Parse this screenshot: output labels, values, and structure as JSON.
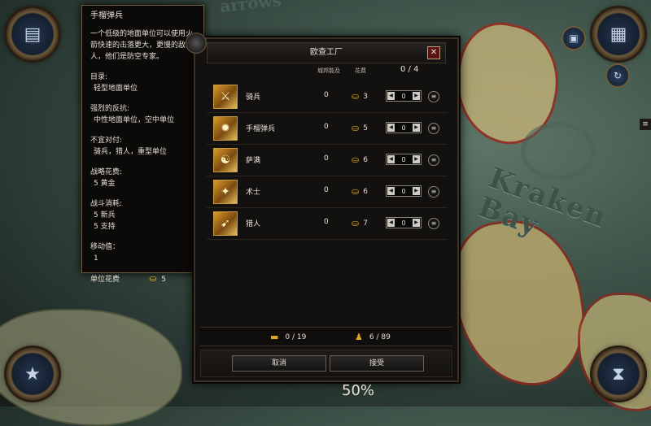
{
  "map": {
    "region_label": "Kraken Bay",
    "top_label": "arrows"
  },
  "tooltip": {
    "title": "手榴弹兵",
    "description": "一个低级的地面单位可以使用火箭快速的击落更大，更慢的敌人，他们是防空专家。",
    "target_label": "目录:",
    "target_value": "轻型地面单位",
    "strong_label": "强烈的反抗:",
    "strong_value": "中性地面单位，空中单位",
    "weak_label": "不宜对付:",
    "weak_value": "骑兵，猎人，重型单位",
    "strat_cost_label": "战略花费:",
    "strat_cost_value": "5 黄金",
    "upkeep_label": "战斗消耗:",
    "upkeep_value_1": "5 新兵",
    "upkeep_value_2": "5 支持",
    "move_label": "移动值：",
    "move_value": "1",
    "unit_cost_label": "单位花费",
    "unit_cost_value": "5"
  },
  "panel": {
    "title": "欧查工厂",
    "col_city": "城邦能及",
    "col_cost": "花费",
    "count": "0 / 4",
    "units": [
      {
        "name": "骑兵",
        "owned": "0",
        "cost": "3",
        "qty": "0",
        "icon": "cavalry-icon"
      },
      {
        "name": "手榴弹兵",
        "owned": "0",
        "cost": "5",
        "qty": "0",
        "icon": "grenadier-icon"
      },
      {
        "name": "萨满",
        "owned": "0",
        "cost": "6",
        "qty": "0",
        "icon": "shaman-icon"
      },
      {
        "name": "术士",
        "owned": "0",
        "cost": "6",
        "qty": "0",
        "icon": "warlock-icon"
      },
      {
        "name": "猎人",
        "owned": "0",
        "cost": "7",
        "qty": "0",
        "icon": "hunter-icon"
      }
    ],
    "resource_1": "0 / 19",
    "resource_2": "6 / 89",
    "cancel_label": "取消",
    "accept_label": "接受"
  },
  "bottom": {
    "percent": "50%"
  },
  "colors": {
    "accent_gold": "#e0a820",
    "close_red": "#5a1510"
  }
}
